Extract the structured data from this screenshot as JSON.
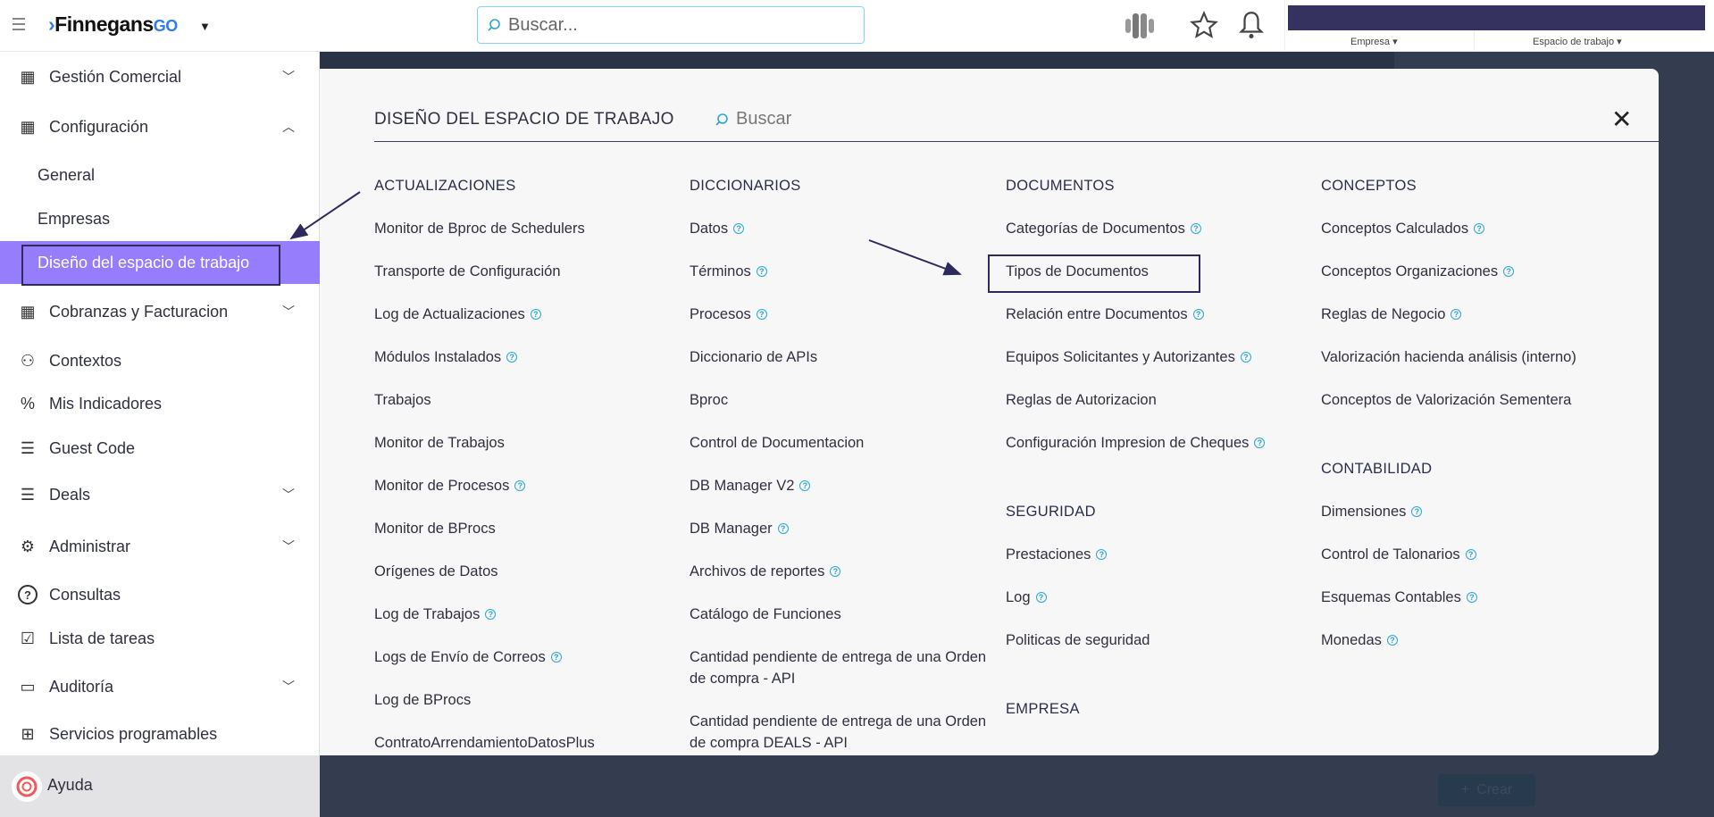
{
  "topbar": {
    "logo_text": "Finnegans",
    "logo_suffix": "GO",
    "search_placeholder": "Buscar...",
    "empresa_label": "Empresa ▾",
    "espacio_label": "Espacio de trabajo ▾",
    "accent": "#35325f"
  },
  "sidebar": {
    "items": [
      {
        "label": "Gestión Comercial",
        "icon": "building-icon"
      },
      {
        "label": "Configuración",
        "icon": "building-icon"
      },
      {
        "label": "General"
      },
      {
        "label": "Empresas"
      },
      {
        "label": "Diseño del espacio de trabajo",
        "active": true
      },
      {
        "label": "Cobranzas y Facturacion",
        "icon": "building-icon"
      },
      {
        "label": "Contextos",
        "icon": "users-icon"
      },
      {
        "label": "Mis Indicadores",
        "icon": "percent-icon"
      },
      {
        "label": "Guest Code",
        "icon": "list-icon"
      },
      {
        "label": "Deals",
        "icon": "list-icon"
      },
      {
        "label": "Administrar",
        "icon": "user-gear-icon"
      },
      {
        "label": "Consultas",
        "icon": "question-icon"
      },
      {
        "label": "Lista de tareas",
        "icon": "clipboard-icon"
      },
      {
        "label": "Auditoría",
        "icon": "archive-icon"
      },
      {
        "label": "Servicios programables",
        "icon": "sitemap-icon"
      }
    ],
    "help_label": "Ayuda",
    "active_color": "#957dfc"
  },
  "modal": {
    "title": "DISEÑO DEL ESPACIO DE TRABAJO",
    "search_placeholder": "Buscar",
    "columns": [
      {
        "sections": [
          {
            "title": "ACTUALIZACIONES",
            "items": [
              {
                "label": "Monitor de Bproc de Schedulers"
              },
              {
                "label": "Transporte de Configuración"
              },
              {
                "label": "Log de Actualizaciones",
                "help": true
              },
              {
                "label": "Módulos Instalados",
                "help": true
              },
              {
                "label": "Trabajos"
              },
              {
                "label": "Monitor de Trabajos"
              },
              {
                "label": "Monitor de Procesos",
                "help": true
              },
              {
                "label": "Monitor de BProcs"
              },
              {
                "label": "Orígenes de Datos"
              },
              {
                "label": "Log de Trabajos",
                "help": true
              },
              {
                "label": "Logs de Envío de Correos",
                "help": true
              },
              {
                "label": "Log de BProcs"
              },
              {
                "label": "ContratoArrendamientoDatosPlus"
              }
            ]
          }
        ]
      },
      {
        "sections": [
          {
            "title": "DICCIONARIOS",
            "items": [
              {
                "label": "Datos",
                "help": true
              },
              {
                "label": "Términos",
                "help": true
              },
              {
                "label": "Procesos",
                "help": true
              },
              {
                "label": "Diccionario de APIs"
              },
              {
                "label": "Bproc"
              },
              {
                "label": "Control de Documentacion"
              },
              {
                "label": "DB Manager V2",
                "help": true
              },
              {
                "label": "DB Manager",
                "help": true
              },
              {
                "label": "Archivos de reportes",
                "help": true
              },
              {
                "label": "Catálogo de Funciones"
              },
              {
                "label": "Cantidad pendiente de entrega de una Orden de compra - API"
              },
              {
                "label": "Cantidad pendiente de entrega de una Orden de compra DEALS - API"
              }
            ]
          }
        ]
      },
      {
        "sections": [
          {
            "title": "DOCUMENTOS",
            "items": [
              {
                "label": "Categorías de Documentos",
                "help": true
              },
              {
                "label": "Tipos de Documentos"
              },
              {
                "label": "Relación entre Documentos",
                "help": true
              },
              {
                "label": "Equipos Solicitantes y Autorizantes",
                "help": true
              },
              {
                "label": "Reglas de Autorizacion"
              },
              {
                "label": "Configuración Impresion de Cheques",
                "help": true
              }
            ]
          },
          {
            "title": "SEGURIDAD",
            "items": [
              {
                "label": "Prestaciones",
                "help": true
              },
              {
                "label": "Log",
                "help": true
              },
              {
                "label": "Politicas de seguridad"
              }
            ]
          },
          {
            "title": "EMPRESA",
            "items": []
          }
        ]
      },
      {
        "sections": [
          {
            "title": "CONCEPTOS",
            "items": [
              {
                "label": "Conceptos Calculados",
                "help": true
              },
              {
                "label": "Conceptos Organizaciones",
                "help": true
              },
              {
                "label": "Reglas de Negocio",
                "help": true
              },
              {
                "label": "Valorización hacienda análisis (interno)"
              },
              {
                "label": "Conceptos de Valorización Sementera"
              }
            ]
          },
          {
            "title": "CONTABILIDAD",
            "items": [
              {
                "label": "Dimensiones",
                "help": true
              },
              {
                "label": "Control de Talonarios",
                "help": true
              },
              {
                "label": "Esquemas Contables",
                "help": true
              },
              {
                "label": "Monedas",
                "help": true
              }
            ]
          }
        ]
      }
    ]
  },
  "background": {
    "create_button": "Crear"
  }
}
